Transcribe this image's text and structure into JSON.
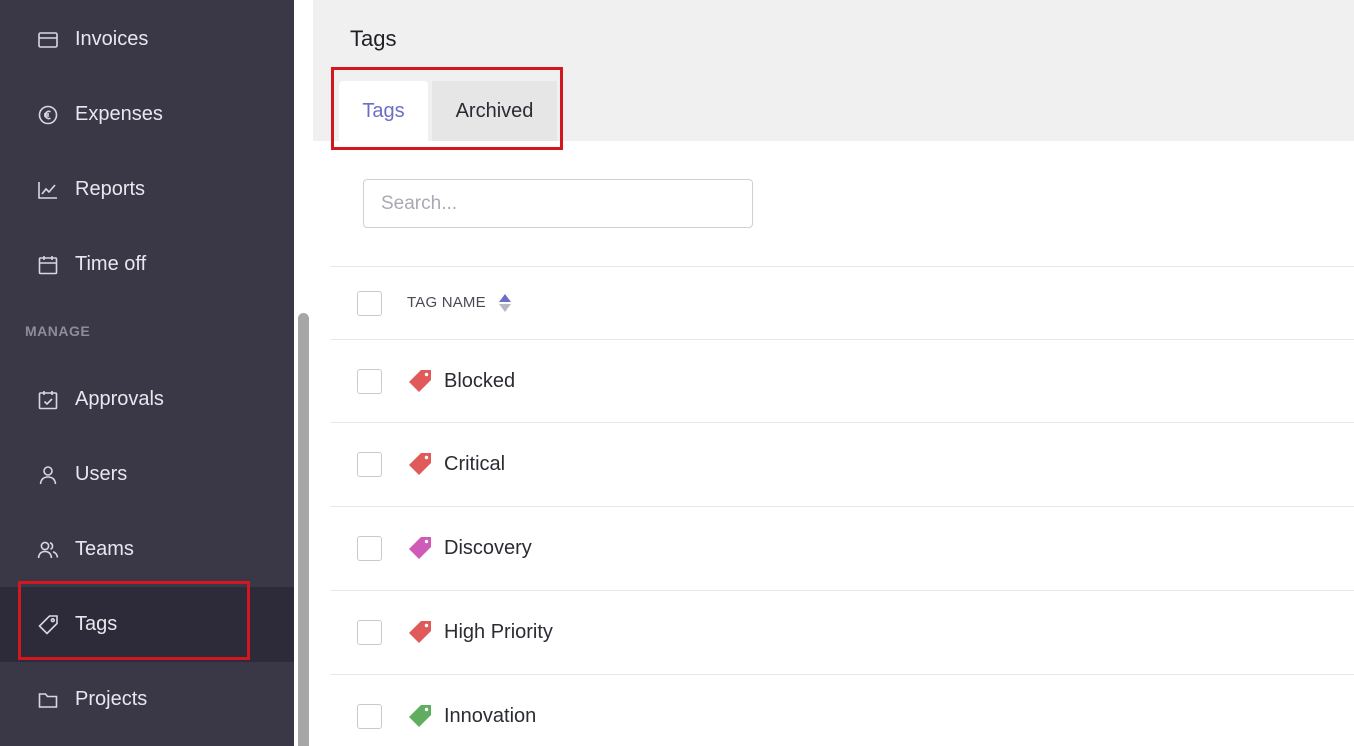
{
  "sidebar": {
    "items": [
      {
        "label": "Invoices",
        "icon": "invoice-icon"
      },
      {
        "label": "Expenses",
        "icon": "euro-icon"
      },
      {
        "label": "Reports",
        "icon": "chart-line-icon"
      },
      {
        "label": "Time off",
        "icon": "calendar-icon"
      },
      {
        "label": "Approvals",
        "icon": "calendar-check-icon"
      },
      {
        "label": "Users",
        "icon": "user-icon"
      },
      {
        "label": "Teams",
        "icon": "team-icon"
      },
      {
        "label": "Tags",
        "icon": "tag-icon",
        "active": true
      },
      {
        "label": "Projects",
        "icon": "folder-icon"
      }
    ],
    "section_manage": "MANAGE"
  },
  "page": {
    "title": "Tags",
    "tabs": [
      {
        "label": "Tags",
        "active": true
      },
      {
        "label": "Archived",
        "active": false
      }
    ],
    "search": {
      "placeholder": "Search...",
      "value": ""
    }
  },
  "table": {
    "header": "TAG NAME",
    "rows": [
      {
        "name": "Blocked",
        "color": "#e05a5a"
      },
      {
        "name": "Critical",
        "color": "#e05a5a"
      },
      {
        "name": "Discovery",
        "color": "#cf5bb8"
      },
      {
        "name": "High Priority",
        "color": "#e05a5a"
      },
      {
        "name": "Innovation",
        "color": "#5fae5f"
      }
    ]
  },
  "colors": {
    "sidebar_bg": "#3a3747",
    "accent": "#6b6fc6",
    "highlight": "#d3171e"
  }
}
